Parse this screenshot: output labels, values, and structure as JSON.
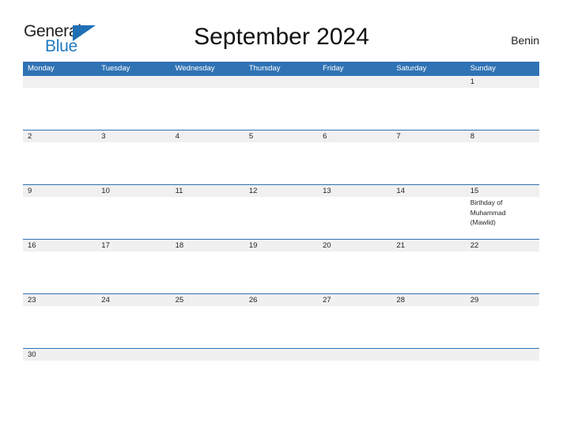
{
  "header": {
    "logo": {
      "word_top": "General",
      "word_bottom": "Blue",
      "triangle_color": "#1f6fb5",
      "blue_text_color": "#1f7ac0"
    },
    "title": "September 2024",
    "country": "Benin"
  },
  "calendar": {
    "accent_color": "#3073b4",
    "day_strip_color": "#f0f0f0",
    "weekdays": [
      "Monday",
      "Tuesday",
      "Wednesday",
      "Thursday",
      "Friday",
      "Saturday",
      "Sunday"
    ],
    "weeks": [
      {
        "days": [
          {
            "number": "",
            "event": ""
          },
          {
            "number": "",
            "event": ""
          },
          {
            "number": "",
            "event": ""
          },
          {
            "number": "",
            "event": ""
          },
          {
            "number": "",
            "event": ""
          },
          {
            "number": "",
            "event": ""
          },
          {
            "number": "1",
            "event": ""
          }
        ]
      },
      {
        "days": [
          {
            "number": "2",
            "event": ""
          },
          {
            "number": "3",
            "event": ""
          },
          {
            "number": "4",
            "event": ""
          },
          {
            "number": "5",
            "event": ""
          },
          {
            "number": "6",
            "event": ""
          },
          {
            "number": "7",
            "event": ""
          },
          {
            "number": "8",
            "event": ""
          }
        ]
      },
      {
        "days": [
          {
            "number": "9",
            "event": ""
          },
          {
            "number": "10",
            "event": ""
          },
          {
            "number": "11",
            "event": ""
          },
          {
            "number": "12",
            "event": ""
          },
          {
            "number": "13",
            "event": ""
          },
          {
            "number": "14",
            "event": ""
          },
          {
            "number": "15",
            "event": "Birthday of Muhammad (Mawlid)"
          }
        ]
      },
      {
        "days": [
          {
            "number": "16",
            "event": ""
          },
          {
            "number": "17",
            "event": ""
          },
          {
            "number": "18",
            "event": ""
          },
          {
            "number": "19",
            "event": ""
          },
          {
            "number": "20",
            "event": ""
          },
          {
            "number": "21",
            "event": ""
          },
          {
            "number": "22",
            "event": ""
          }
        ]
      },
      {
        "days": [
          {
            "number": "23",
            "event": ""
          },
          {
            "number": "24",
            "event": ""
          },
          {
            "number": "25",
            "event": ""
          },
          {
            "number": "26",
            "event": ""
          },
          {
            "number": "27",
            "event": ""
          },
          {
            "number": "28",
            "event": ""
          },
          {
            "number": "29",
            "event": ""
          }
        ]
      },
      {
        "days": [
          {
            "number": "30",
            "event": ""
          },
          {
            "number": "",
            "event": ""
          },
          {
            "number": "",
            "event": ""
          },
          {
            "number": "",
            "event": ""
          },
          {
            "number": "",
            "event": ""
          },
          {
            "number": "",
            "event": ""
          },
          {
            "number": "",
            "event": ""
          }
        ]
      }
    ]
  }
}
